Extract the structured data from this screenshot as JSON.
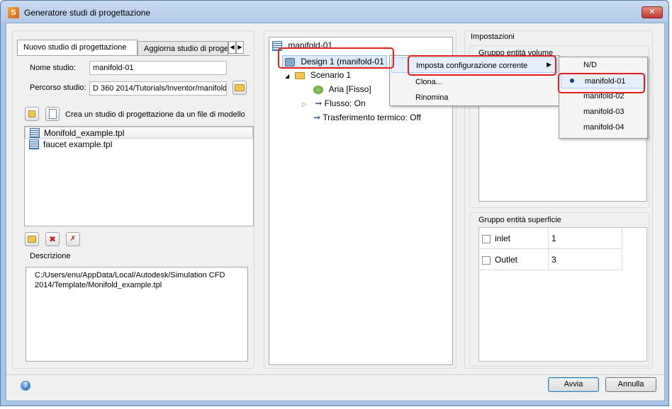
{
  "window": {
    "title": "Generatore studi di progettazione",
    "close_glyph": "✕"
  },
  "left": {
    "tabs": [
      "Nuovo studio di progettazione",
      "Aggiorna studio di proge"
    ],
    "study_name_label": "Nome studio:",
    "study_name_value": "manifold-01",
    "study_path_label": "Percorso studio:",
    "study_path_value": "D 360 2014/Tutorials/Inventor/manifold",
    "create_from_model_label": "Crea un studio di progettazione da un file di modello",
    "templates": [
      "Monifold_example.tpl",
      "faucet example.tpl"
    ],
    "description_title": "Descrizione",
    "description_text": "C:/Users/enu/AppData/Local/Autodesk/Simulation CFD 2014/Template/Monifold_example.tpl"
  },
  "tree": {
    "root": "manifold-01",
    "design": "Design 1 (manifold-01",
    "scenario": "Scenario 1",
    "air": "Aria [Fisso]",
    "flow": "Flusso: On",
    "heat": "Trasferimento termico: Off"
  },
  "context_menu": {
    "items": [
      "Imposta configurazione corrente",
      "Clona...",
      "Rinomina"
    ]
  },
  "submenu": {
    "items": [
      "N/D",
      "manifold-01",
      "manifold-02",
      "manifold-03",
      "manifold-04"
    ],
    "selected": "manifold-01"
  },
  "settings": {
    "title": "Impostazioni",
    "volume_group": "Gruppo entità volume",
    "surface_group": "Gruppo entità superficie",
    "surfaces": [
      {
        "name": "inlet",
        "value": "1"
      },
      {
        "name": "Outlet",
        "value": "3"
      }
    ]
  },
  "footer": {
    "help_glyph": "?",
    "ok": "Avvia",
    "cancel": "Annulla"
  },
  "colors": {
    "highlight": "#e01e1e",
    "title_bar": "#b3cbe8"
  }
}
